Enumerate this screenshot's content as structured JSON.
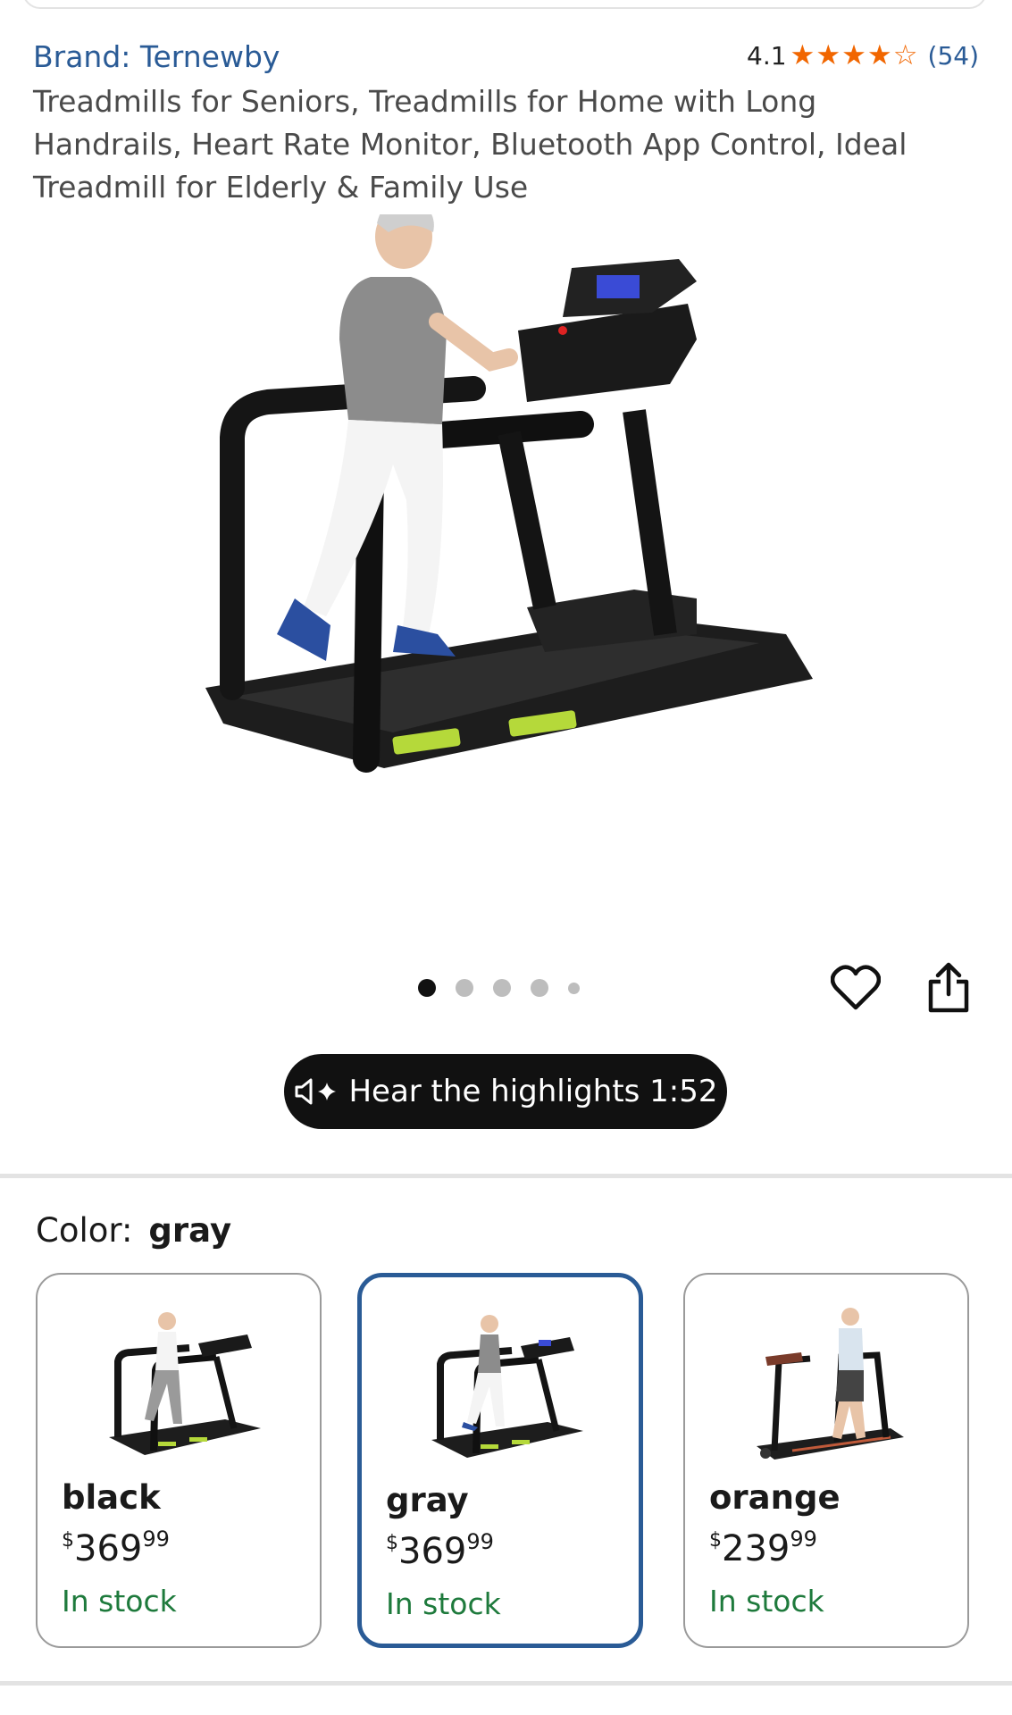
{
  "product": {
    "brand": "Brand: Ternewby",
    "rating_score": "4.1",
    "rating_stars": "★★★★☆",
    "rating_value": 4.1,
    "review_count": "(54)",
    "title": "Treadmills for Seniors, Treadmills for Home with Long Handrails, Heart Rate Monitor, Bluetooth App Control, Ideal Treadmill for Elderly & Family Use"
  },
  "gallery": {
    "image": "treadmill-with-senior-woman-walking",
    "dot_count": 5,
    "active_index": 0
  },
  "actions": {
    "favorite_icon": "heart-icon",
    "share_icon": "share-icon"
  },
  "audio": {
    "label": "Hear the highlights 1:52",
    "icon": "speaker-sparkle-icon"
  },
  "color": {
    "label": "Color:",
    "selected": "gray",
    "options": [
      {
        "name": "black",
        "currency": "$",
        "dollars": "369",
        "cents": "99",
        "stock": "In stock",
        "selected": false
      },
      {
        "name": "gray",
        "currency": "$",
        "dollars": "369",
        "cents": "99",
        "stock": "In stock",
        "selected": true
      },
      {
        "name": "orange",
        "currency": "$",
        "dollars": "239",
        "cents": "99",
        "stock": "In stock",
        "selected": false
      }
    ]
  },
  "colors": {
    "link": "#2a5b96",
    "star": "#f16600",
    "stock": "#1e7a3c",
    "selected_border": "#2a5b96"
  }
}
